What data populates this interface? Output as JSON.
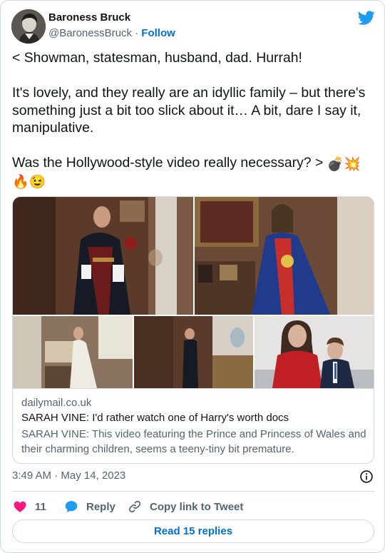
{
  "author": {
    "name": "Baroness Bruck",
    "handle": "@BaronessBruck",
    "separator": " · ",
    "follow_label": "Follow"
  },
  "tweet": {
    "text_main": "< Showman, statesman, husband, dad. Hurrah!\n\nIt's lovely, and they really are an idyllic family – but there's something just a bit too slick about it… A bit, dare I say it, manipulative.\n\nWas the Hollywood-style video really necessary? > ",
    "emoji_bomb": "💣",
    "emoji_collision": "💥",
    "emoji_fire": "🔥",
    "emoji_wink": "😉"
  },
  "link_card": {
    "domain": "dailymail.co.uk",
    "title": "SARAH VINE: I'd rather watch one of Harry's worth docs",
    "description": "SARAH VINE: This video featuring the Prince and Princess of Wales and their charming children, seems a teeny-tiny bit premature."
  },
  "meta": {
    "timestamp": "3:49 AM · May 14, 2023"
  },
  "actions": {
    "like_count": "11",
    "reply_label": "Reply",
    "copy_label": "Copy link to Tweet"
  },
  "read_replies_label": "Read 15 replies",
  "colors": {
    "accent": "#006fd6",
    "twitter_blue": "#1d9bf0",
    "like_pink": "#f91880",
    "secondary_text": "#536471",
    "border": "#cfd9de"
  },
  "icons": [
    "twitter-bird-icon",
    "info-icon",
    "heart-icon",
    "reply-bubble-icon",
    "link-icon"
  ]
}
